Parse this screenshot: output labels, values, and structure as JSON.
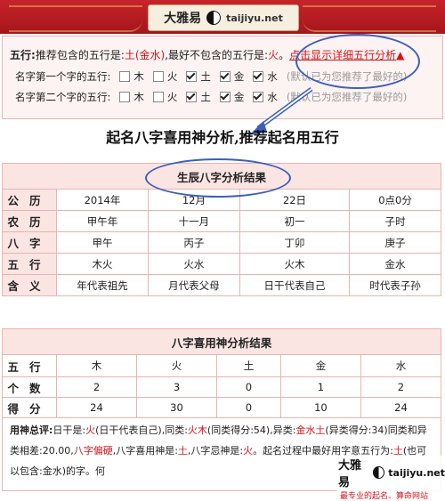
{
  "site": {
    "logo_cn": "大雅易",
    "logo_en": "taijiyu.net"
  },
  "wuxing_panel": {
    "prefix": "五行:",
    "recommend_text": "推荐包含的五行是:",
    "recommend_value": "土(金水)",
    "exclude_text": ",最好不包含的五行是:",
    "exclude_value": "火",
    "period": "。",
    "detail_link": "点击显示详细五行分析",
    "first_label": "名字第一个字的五行:",
    "second_label": "名字第二个字的五行:",
    "elements": [
      "木",
      "火",
      "土",
      "金",
      "水"
    ],
    "first_checked": [
      false,
      false,
      true,
      true,
      true
    ],
    "second_checked": [
      false,
      false,
      true,
      true,
      true
    ],
    "default_note": "(默认已为您推荐了最好的)"
  },
  "page_heading": "起名八字喜用神分析,推荐起名用五行",
  "bazi_table": {
    "title": "生辰八字分析结果",
    "rows": [
      {
        "label": "公历",
        "cells": [
          "2014年",
          "12月",
          "22日",
          "0点0分"
        ]
      },
      {
        "label": "农历",
        "cells": [
          "甲午年",
          "十一月",
          "初一",
          "子时"
        ]
      },
      {
        "label": "八字",
        "cells": [
          "甲午",
          "丙子",
          "丁卯",
          "庚子"
        ]
      },
      {
        "label": "五行",
        "cells": [
          "木火",
          "火水",
          "火木",
          "金水"
        ]
      },
      {
        "label": "含义",
        "cells": [
          "年代表祖先",
          "月代表父母",
          "日干代表自己",
          "时代表子孙"
        ]
      }
    ]
  },
  "xiyong_table": {
    "title": "八字喜用神分析结果",
    "rows": [
      {
        "label": "五行",
        "cells": [
          "木",
          "火",
          "土",
          "金",
          "水"
        ]
      },
      {
        "label": "个数",
        "cells": [
          "2",
          "3",
          "0",
          "1",
          "2"
        ]
      },
      {
        "label": "得分",
        "cells": [
          "24",
          "30",
          "0",
          "10",
          "24"
        ]
      }
    ]
  },
  "summary": {
    "label": "用神总评:",
    "p1": "日干是:",
    "p1v": "火",
    "p2": "(日干代表自己),同类:",
    "p2v": "火木",
    "p3": "(同类得分:54),异类:",
    "p3v": "金水土",
    "p4": "(异类得分:34)同类和异类相差:20.00,",
    "p4v": "八字偏硬",
    "p5": ",八字喜用神是:",
    "p5v": "土",
    "p6": ",八字忌神是:",
    "p7v": "火",
    "p7": "。起名过程中最好用字意五行为:",
    "p8v": "土",
    "p8": "(也可以包含:金水)的字。",
    "trail": "何"
  },
  "watermark": {
    "cn": "大雅易",
    "en": "taijiyu.net",
    "sub": "最专业的起名、算命网站"
  }
}
